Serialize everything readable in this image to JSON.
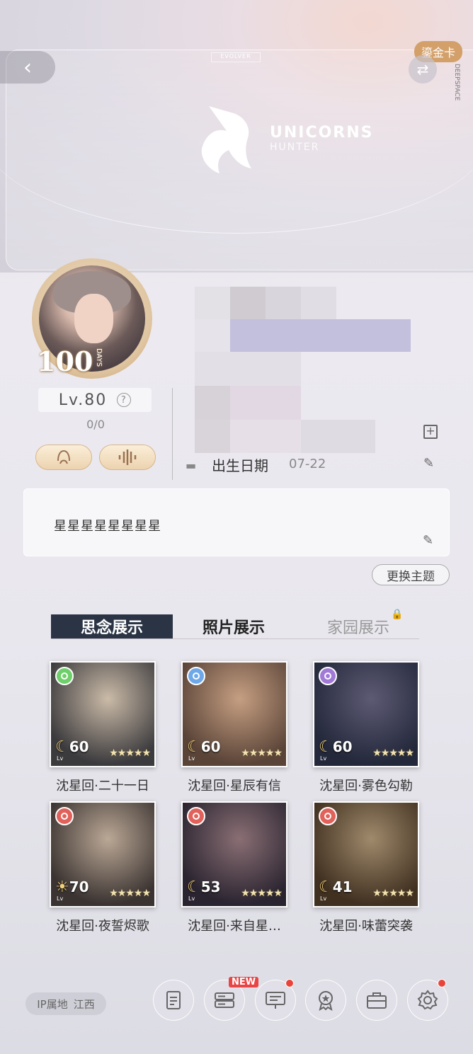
{
  "header": {
    "back_icon": "chevron-left-icon",
    "card_badge": "鎏金卡",
    "swap_icon": "swap-arrows-icon",
    "evolver_label": "EVOLVER",
    "brand_line1": "UNICORNS",
    "brand_line2": "HUNTER",
    "deepspace_label": "DEEPSPACE"
  },
  "profile": {
    "days_badge": "100",
    "days_sub": "DAYS",
    "level": "Lv.80",
    "help_glyph": "?",
    "exp": "0/0",
    "voice_icon": "headset-icon",
    "audio_icon": "sound-wave-icon",
    "birthday_label": "出生日期",
    "birthday_value": "07-22",
    "signature": "星星星星星星星星",
    "change_theme": "更换主题"
  },
  "tabs": [
    {
      "label": "思念展示",
      "active": true
    },
    {
      "label": "照片展示",
      "active": false
    },
    {
      "label": "家园展示",
      "active": false,
      "locked": true
    }
  ],
  "cards": [
    {
      "title": "沈星回·二十一日",
      "level": "60",
      "dot_color": "#6fcf6a",
      "icon": "moon",
      "bg": [
        "#3b3a3d",
        "#cbbba8"
      ]
    },
    {
      "title": "沈星回·星辰有信",
      "level": "60",
      "dot_color": "#6fa8e8",
      "icon": "moon",
      "bg": [
        "#5a4438",
        "#c69f82"
      ]
    },
    {
      "title": "沈星回·雾色勾勒",
      "level": "60",
      "dot_color": "#a17ad8",
      "icon": "moon",
      "bg": [
        "#23283a",
        "#5d5a74"
      ]
    },
    {
      "title": "沈星回·夜誓烬歌",
      "level": "70",
      "dot_color": "#e0625a",
      "icon": "sun",
      "bg": [
        "#3a3331",
        "#bba896"
      ]
    },
    {
      "title": "沈星回·来自星…",
      "level": "53",
      "dot_color": "#e0625a",
      "icon": "moon",
      "bg": [
        "#2a2430",
        "#8a6f74"
      ]
    },
    {
      "title": "沈星回·味蕾突袭",
      "level": "41",
      "dot_color": "#e0625a",
      "icon": "moon",
      "bg": [
        "#403020",
        "#a08a6c"
      ]
    }
  ],
  "footer": {
    "ip_label": "IP属地",
    "ip_value": "江西",
    "new_badge": "NEW",
    "buttons": [
      "document-icon",
      "list-icon",
      "chat-board-icon",
      "badge-icon",
      "briefcase-icon",
      "gear-icon"
    ]
  },
  "colors": {
    "tab_active_bg": "#2b3445",
    "gold": "#d3a06a",
    "notification": "#e8443a"
  }
}
